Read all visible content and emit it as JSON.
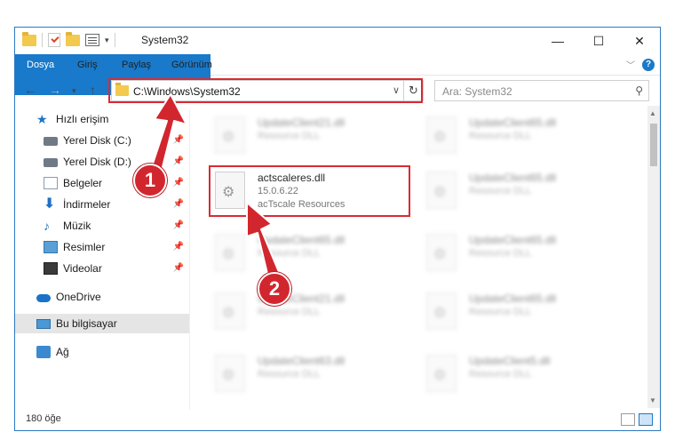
{
  "window": {
    "title": "System32"
  },
  "ribbon": {
    "tabs": [
      "Dosya",
      "Giriş",
      "Paylaş",
      "Görünüm"
    ]
  },
  "address": {
    "path": "C:\\Windows\\System32",
    "search_placeholder": "Ara: System32"
  },
  "nav": {
    "items": [
      {
        "label": "Hızlı erişim",
        "icon": "star-icon",
        "pinned": false
      },
      {
        "label": "Yerel Disk (C:)",
        "icon": "disk-icon",
        "pinned": true
      },
      {
        "label": "Yerel Disk (D:)",
        "icon": "disk-icon",
        "pinned": true
      },
      {
        "label": "Belgeler",
        "icon": "documents-icon",
        "pinned": true
      },
      {
        "label": "İndirmeler",
        "icon": "download-icon",
        "pinned": true
      },
      {
        "label": "Müzik",
        "icon": "music-icon",
        "pinned": true
      },
      {
        "label": "Resimler",
        "icon": "pictures-icon",
        "pinned": true
      },
      {
        "label": "Videolar",
        "icon": "videos-icon",
        "pinned": true
      },
      {
        "label": "OneDrive",
        "icon": "cloud-icon",
        "pinned": false
      },
      {
        "label": "Bu bilgisayar",
        "icon": "computer-icon",
        "pinned": false
      },
      {
        "label": "Ağ",
        "icon": "network-icon",
        "pinned": false
      }
    ]
  },
  "files": {
    "highlighted": {
      "name": "actscaleres.dll",
      "version": "15.0.6.22",
      "description": "acTscale Resources"
    },
    "blurred": [
      {
        "name": "UpdateClient21.dll",
        "description": "Resource DLL"
      },
      {
        "name": "UpdateClient65.dll",
        "description": "Resource DLL"
      },
      {
        "name": "UpdateClient65.dll",
        "description": "Resource DLL"
      },
      {
        "name": "UpdateClient65.dll",
        "description": "Resource DLL"
      },
      {
        "name": "UpdateClient65.dll",
        "description": "Resource DLL"
      },
      {
        "name": "UpdateClient21.dll",
        "description": "Resource DLL"
      },
      {
        "name": "UpdateClient65.dll",
        "description": "Resource DLL"
      },
      {
        "name": "UpdateClient63.dll",
        "description": "Resource DLL"
      },
      {
        "name": "UpdateClient5.dll",
        "description": "Resource DLL"
      }
    ]
  },
  "status": {
    "count": "180 öğe"
  },
  "callouts": [
    "1",
    "2"
  ],
  "colors": {
    "accent": "#1979ca",
    "highlight": "#d92b32"
  }
}
